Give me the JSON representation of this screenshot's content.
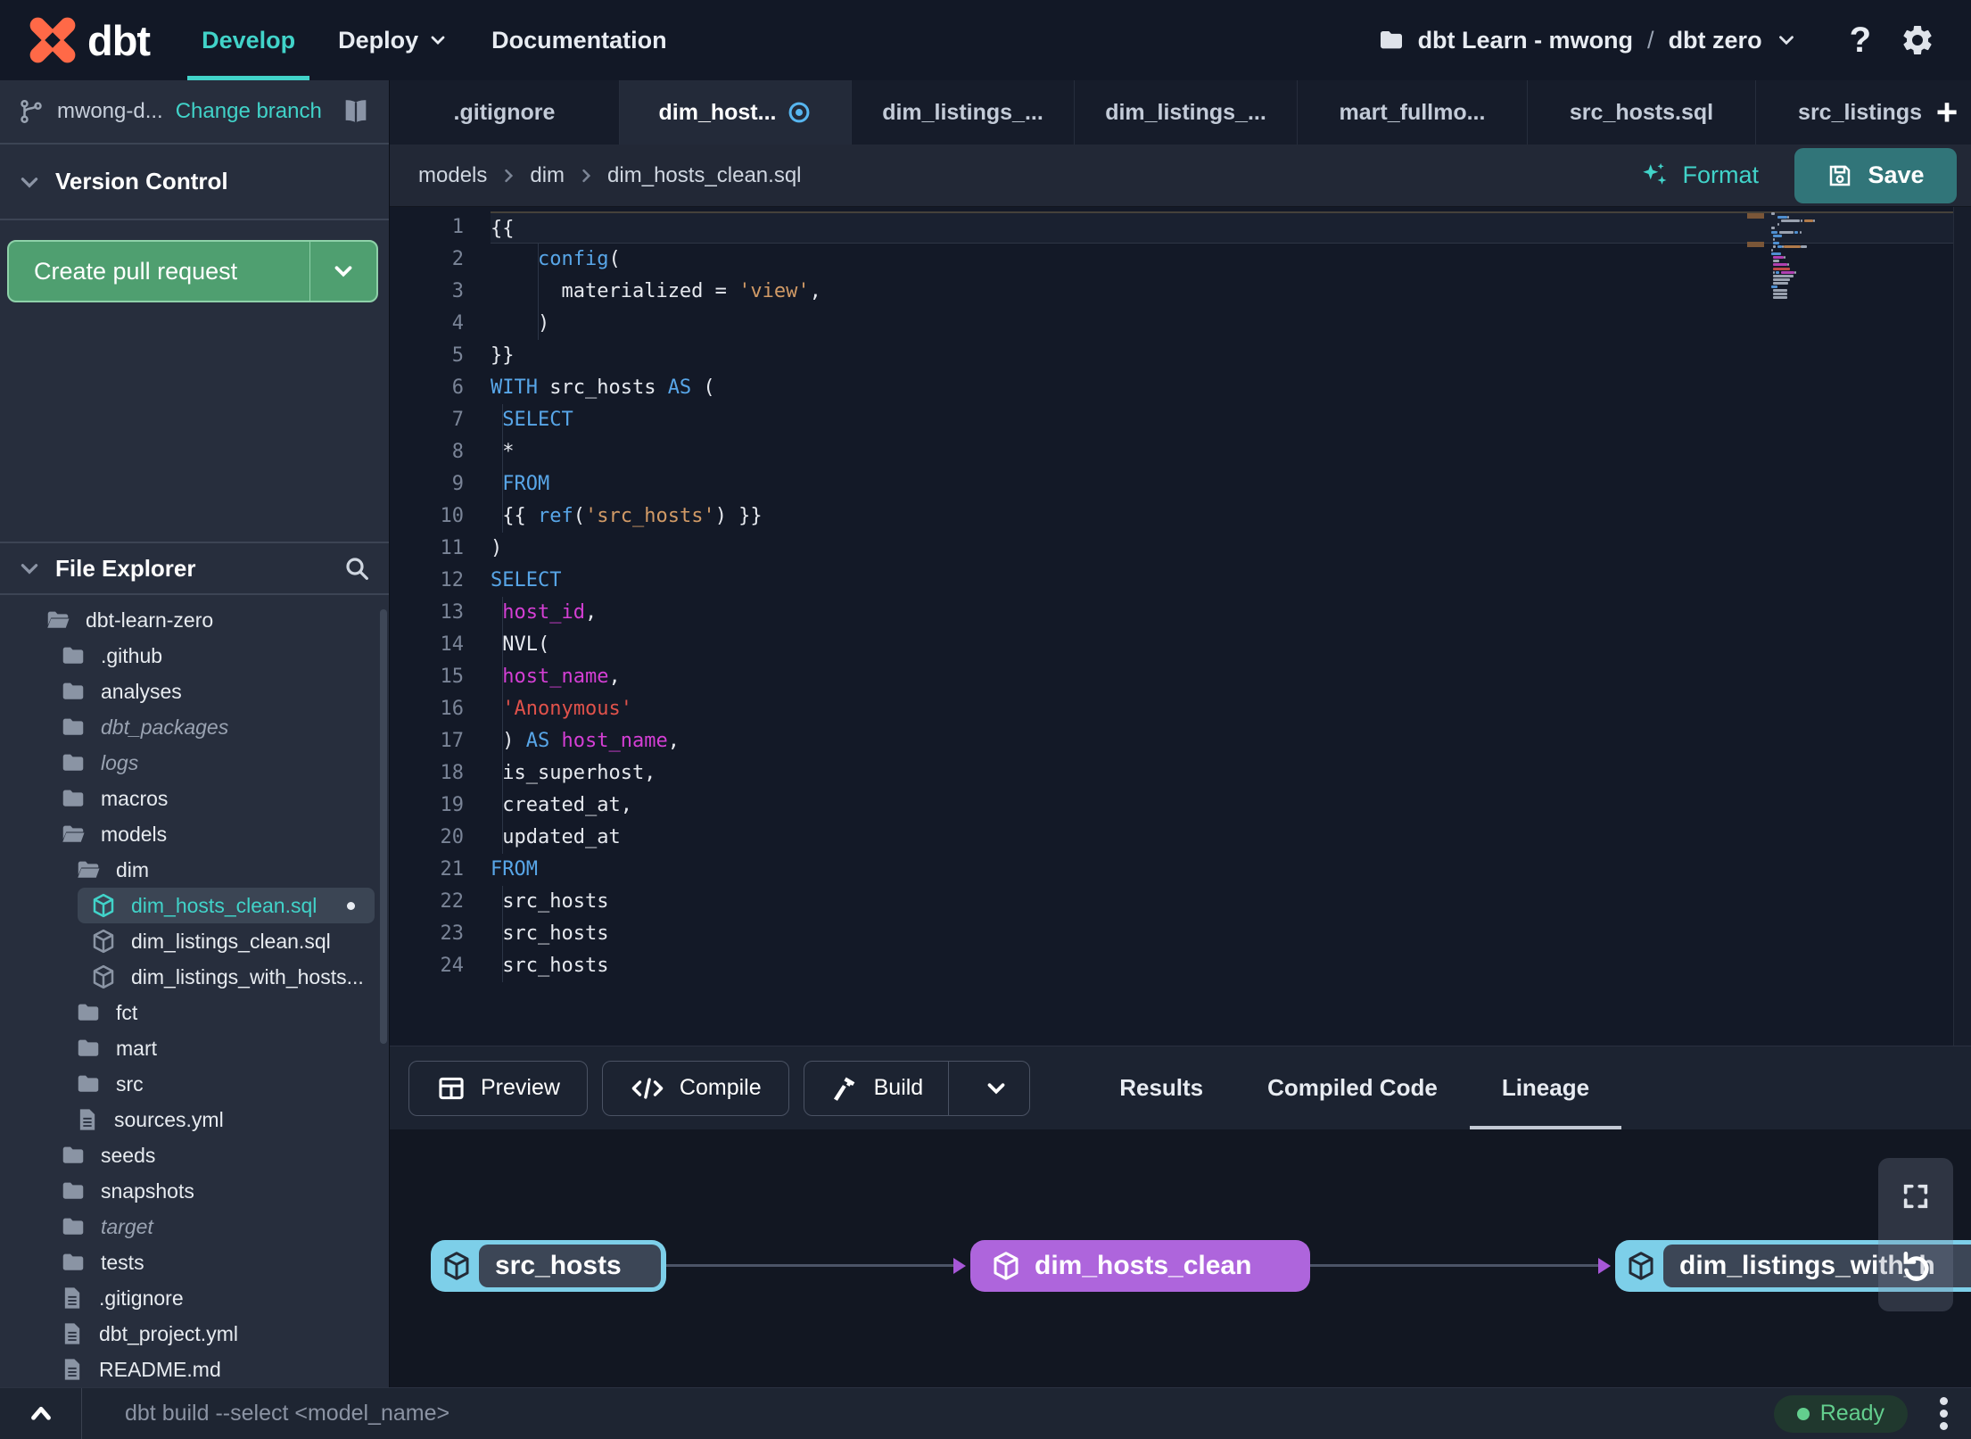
{
  "colors": {
    "accent_teal": "#41d3c9",
    "save_teal": "#317579",
    "pr_green": "#4f9f70",
    "node_blue": "#7dcfe9",
    "node_purple": "#ae65dc",
    "ready_green": "#63cf8e",
    "modified_blue": "#57b6f0",
    "keyword_blue": "#58a6e8",
    "string_orange": "#d19a66",
    "string_red": "#e0524b",
    "column_magenta": "#d43fd4"
  },
  "navbar": {
    "logo_text": "dbt",
    "items": [
      {
        "label": "Develop",
        "active": true
      },
      {
        "label": "Deploy",
        "caret": true
      },
      {
        "label": "Documentation"
      }
    ],
    "project": {
      "account": "dbt Learn - mwong",
      "separator": "/",
      "name": "dbt zero"
    }
  },
  "sidebar": {
    "branch": {
      "name": "mwong-d...",
      "change_link": "Change branch"
    },
    "version_control": {
      "title": "Version Control",
      "create_pr_label": "Create pull request"
    },
    "file_explorer": {
      "title": "File Explorer",
      "tree": [
        {
          "label": "dbt-learn-zero",
          "icon": "folder-open-icon",
          "depth": 0
        },
        {
          "label": ".github",
          "icon": "folder-icon",
          "depth": 1
        },
        {
          "label": "analyses",
          "icon": "folder-icon",
          "depth": 1
        },
        {
          "label": "dbt_packages",
          "icon": "folder-icon",
          "depth": 1,
          "italic": true
        },
        {
          "label": "logs",
          "icon": "folder-icon",
          "depth": 1,
          "italic": true
        },
        {
          "label": "macros",
          "icon": "folder-icon",
          "depth": 1
        },
        {
          "label": "models",
          "icon": "folder-open-icon",
          "depth": 1
        },
        {
          "label": "dim",
          "icon": "folder-open-icon",
          "depth": 2
        },
        {
          "label": "dim_hosts_clean.sql",
          "icon": "model-cube-icon",
          "depth": 3,
          "selected": true,
          "modified": true
        },
        {
          "label": "dim_listings_clean.sql",
          "icon": "model-cube-icon",
          "depth": 3
        },
        {
          "label": "dim_listings_with_hosts...",
          "icon": "model-cube-icon",
          "depth": 3
        },
        {
          "label": "fct",
          "icon": "folder-icon",
          "depth": 2
        },
        {
          "label": "mart",
          "icon": "folder-icon",
          "depth": 2
        },
        {
          "label": "src",
          "icon": "folder-icon",
          "depth": 2
        },
        {
          "label": "sources.yml",
          "icon": "file-icon",
          "depth": 2
        },
        {
          "label": "seeds",
          "icon": "folder-icon",
          "depth": 1
        },
        {
          "label": "snapshots",
          "icon": "folder-icon",
          "depth": 1
        },
        {
          "label": "target",
          "icon": "folder-icon",
          "depth": 1,
          "italic": true
        },
        {
          "label": "tests",
          "icon": "folder-icon",
          "depth": 1
        },
        {
          "label": ".gitignore",
          "icon": "file-icon",
          "depth": 1
        },
        {
          "label": "dbt_project.yml",
          "icon": "file-icon",
          "depth": 1
        },
        {
          "label": "README.md",
          "icon": "file-icon",
          "depth": 1
        }
      ]
    }
  },
  "editor": {
    "tabs": [
      {
        "label": ".gitignore"
      },
      {
        "label": "dim_host...",
        "active": true,
        "modified": true
      },
      {
        "label": "dim_listings_..."
      },
      {
        "label": "dim_listings_..."
      },
      {
        "label": "mart_fullmo..."
      },
      {
        "label": "src_hosts.sql"
      },
      {
        "label": "src_listings."
      }
    ],
    "new_tab_label": "+",
    "breadcrumb": [
      "models",
      "dim",
      "dim_hosts_clean.sql"
    ],
    "actions": {
      "format": "Format",
      "save": "Save"
    },
    "code": {
      "lines": [
        {
          "n": "1",
          "current": true,
          "tokens": [
            {
              "t": "{{",
              "c": "plain"
            }
          ]
        },
        {
          "n": "2",
          "guides": [
            4
          ],
          "tokens": [
            {
              "t": "    ",
              "c": "plain"
            },
            {
              "t": "config",
              "c": "kw"
            },
            {
              "t": "(",
              "c": "plain"
            }
          ]
        },
        {
          "n": "3",
          "guides": [
            4
          ],
          "tokens": [
            {
              "t": "      ",
              "c": "plain"
            },
            {
              "t": "materialized",
              "c": "plain"
            },
            {
              "t": " = ",
              "c": "plain"
            },
            {
              "t": "'view'",
              "c": "str"
            },
            {
              "t": ",",
              "c": "plain"
            }
          ]
        },
        {
          "n": "4",
          "guides": [
            4
          ],
          "tokens": [
            {
              "t": "    )",
              "c": "plain"
            }
          ]
        },
        {
          "n": "5",
          "tokens": [
            {
              "t": "}}",
              "c": "plain"
            }
          ]
        },
        {
          "n": "6",
          "tokens": [
            {
              "t": "WITH",
              "c": "kw"
            },
            {
              "t": " src_hosts ",
              "c": "plain"
            },
            {
              "t": "AS",
              "c": "kw"
            },
            {
              "t": " (",
              "c": "plain"
            }
          ]
        },
        {
          "n": "7",
          "guides": [
            1
          ],
          "tokens": [
            {
              "t": " ",
              "c": "plain"
            },
            {
              "t": "SELECT",
              "c": "kw"
            }
          ]
        },
        {
          "n": "8",
          "guides": [
            1
          ],
          "tokens": [
            {
              "t": " *",
              "c": "plain"
            }
          ]
        },
        {
          "n": "9",
          "guides": [
            1
          ],
          "tokens": [
            {
              "t": " ",
              "c": "plain"
            },
            {
              "t": "FROM",
              "c": "kw"
            }
          ]
        },
        {
          "n": "10",
          "guides": [
            1
          ],
          "tokens": [
            {
              "t": " {{ ",
              "c": "plain"
            },
            {
              "t": "ref",
              "c": "kw"
            },
            {
              "t": "(",
              "c": "plain"
            },
            {
              "t": "'src_hosts'",
              "c": "str"
            },
            {
              "t": ") }}",
              "c": "plain"
            }
          ]
        },
        {
          "n": "11",
          "tokens": [
            {
              "t": ")",
              "c": "plain"
            }
          ]
        },
        {
          "n": "12",
          "tokens": [
            {
              "t": "SELECT",
              "c": "kw"
            }
          ]
        },
        {
          "n": "13",
          "guides": [
            1
          ],
          "tokens": [
            {
              "t": " ",
              "c": "plain"
            },
            {
              "t": "host_id",
              "c": "col"
            },
            {
              "t": ",",
              "c": "plain"
            }
          ]
        },
        {
          "n": "14",
          "guides": [
            1
          ],
          "tokens": [
            {
              "t": " NVL(",
              "c": "plain"
            }
          ]
        },
        {
          "n": "15",
          "guides": [
            1
          ],
          "tokens": [
            {
              "t": " ",
              "c": "plain"
            },
            {
              "t": "host_name",
              "c": "col"
            },
            {
              "t": ",",
              "c": "plain"
            }
          ]
        },
        {
          "n": "16",
          "guides": [
            1
          ],
          "tokens": [
            {
              "t": " ",
              "c": "plain"
            },
            {
              "t": "'Anonymous'",
              "c": "strred"
            }
          ]
        },
        {
          "n": "17",
          "guides": [
            1
          ],
          "tokens": [
            {
              "t": " ) ",
              "c": "plain"
            },
            {
              "t": "AS",
              "c": "kw"
            },
            {
              "t": " ",
              "c": "plain"
            },
            {
              "t": "host_name",
              "c": "col"
            },
            {
              "t": ",",
              "c": "plain"
            }
          ]
        },
        {
          "n": "18",
          "guides": [
            1
          ],
          "tokens": [
            {
              "t": " is_superhost,",
              "c": "plain"
            }
          ]
        },
        {
          "n": "19",
          "guides": [
            1
          ],
          "tokens": [
            {
              "t": " created_at,",
              "c": "plain"
            }
          ]
        },
        {
          "n": "20",
          "guides": [
            1
          ],
          "tokens": [
            {
              "t": " updated_at",
              "c": "plain"
            }
          ]
        },
        {
          "n": "21",
          "tokens": [
            {
              "t": "FROM",
              "c": "kw"
            }
          ]
        },
        {
          "n": "22",
          "guides": [
            1
          ],
          "tokens": [
            {
              "t": " src_hosts",
              "c": "plain"
            }
          ]
        },
        {
          "n": "23",
          "guides": [
            1
          ],
          "tokens": [
            {
              "t": " src_hosts",
              "c": "plain"
            }
          ]
        },
        {
          "n": "24",
          "guides": [
            1
          ],
          "tokens": [
            {
              "t": " src_hosts",
              "c": "plain"
            }
          ]
        }
      ]
    }
  },
  "bottom_panel": {
    "buttons": [
      {
        "label": "Preview",
        "icon": "table-icon"
      },
      {
        "label": "Compile",
        "icon": "code-icon"
      },
      {
        "label": "Build",
        "icon": "hammer-icon",
        "split": true
      }
    ],
    "tabs": [
      {
        "label": "Results"
      },
      {
        "label": "Compiled Code"
      },
      {
        "label": "Lineage",
        "active": true
      }
    ],
    "lineage": {
      "nodes": [
        {
          "label": "src_hosts",
          "type": "source"
        },
        {
          "label": "dim_hosts_clean",
          "type": "model"
        },
        {
          "label": "dim_listings_with_h",
          "type": "source"
        }
      ]
    }
  },
  "status_bar": {
    "command_placeholder": "dbt build --select <model_name>",
    "status": "Ready"
  }
}
